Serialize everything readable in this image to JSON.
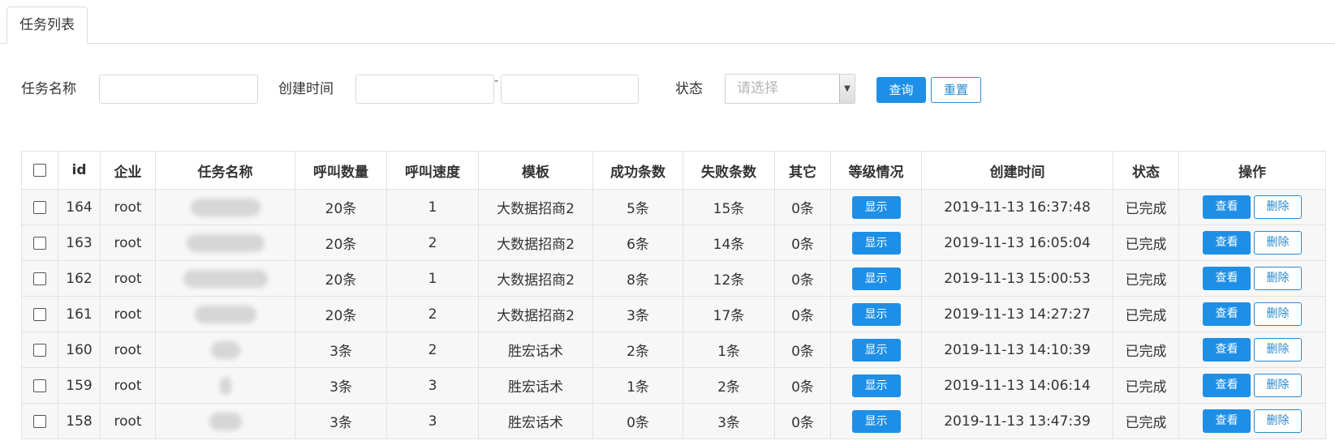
{
  "tabs": [
    {
      "label": "任务列表"
    }
  ],
  "filter": {
    "task_name_label": "任务名称",
    "task_name_value": "",
    "created_label": "创建时间",
    "created_from": "",
    "created_separator": "-",
    "created_to": "",
    "status_label": "状态",
    "status_placeholder": "请选择",
    "search_button": "查询",
    "reset_button": "重置"
  },
  "table": {
    "columns": [
      "id",
      "企业",
      "任务名称",
      "呼叫数量",
      "呼叫速度",
      "模板",
      "成功条数",
      "失败条数",
      "其它",
      "等级情况",
      "创建时间",
      "状态",
      "操作"
    ],
    "show_label": "显示",
    "view_label": "查看",
    "delete_label": "删除",
    "rows": [
      {
        "id": "164",
        "company": "root",
        "call_count": "20条",
        "call_speed": "1",
        "template": "大数据招商2",
        "success": "5条",
        "fail": "15条",
        "other": "0条",
        "created": "2019-11-13 16:37:48",
        "status": "已完成"
      },
      {
        "id": "163",
        "company": "root",
        "call_count": "20条",
        "call_speed": "2",
        "template": "大数据招商2",
        "success": "6条",
        "fail": "14条",
        "other": "0条",
        "created": "2019-11-13 16:05:04",
        "status": "已完成"
      },
      {
        "id": "162",
        "company": "root",
        "call_count": "20条",
        "call_speed": "1",
        "template": "大数据招商2",
        "success": "8条",
        "fail": "12条",
        "other": "0条",
        "created": "2019-11-13 15:00:53",
        "status": "已完成"
      },
      {
        "id": "161",
        "company": "root",
        "call_count": "20条",
        "call_speed": "2",
        "template": "大数据招商2",
        "success": "3条",
        "fail": "17条",
        "other": "0条",
        "created": "2019-11-13 14:27:27",
        "status": "已完成"
      },
      {
        "id": "160",
        "company": "root",
        "call_count": "3条",
        "call_speed": "2",
        "template": "胜宏话术",
        "success": "2条",
        "fail": "1条",
        "other": "0条",
        "created": "2019-11-13 14:10:39",
        "status": "已完成"
      },
      {
        "id": "159",
        "company": "root",
        "call_count": "3条",
        "call_speed": "3",
        "template": "胜宏话术",
        "success": "1条",
        "fail": "2条",
        "other": "0条",
        "created": "2019-11-13 14:06:14",
        "status": "已完成"
      },
      {
        "id": "158",
        "company": "root",
        "call_count": "3条",
        "call_speed": "3",
        "template": "胜宏话术",
        "success": "0条",
        "fail": "3条",
        "other": "0条",
        "created": "2019-11-13 13:47:39",
        "status": "已完成"
      }
    ]
  },
  "colors": {
    "primary": "#1e8fe6",
    "outline": "#2b8ad0",
    "row_bg": "#f7f7f7",
    "border": "#e2e2e2"
  }
}
